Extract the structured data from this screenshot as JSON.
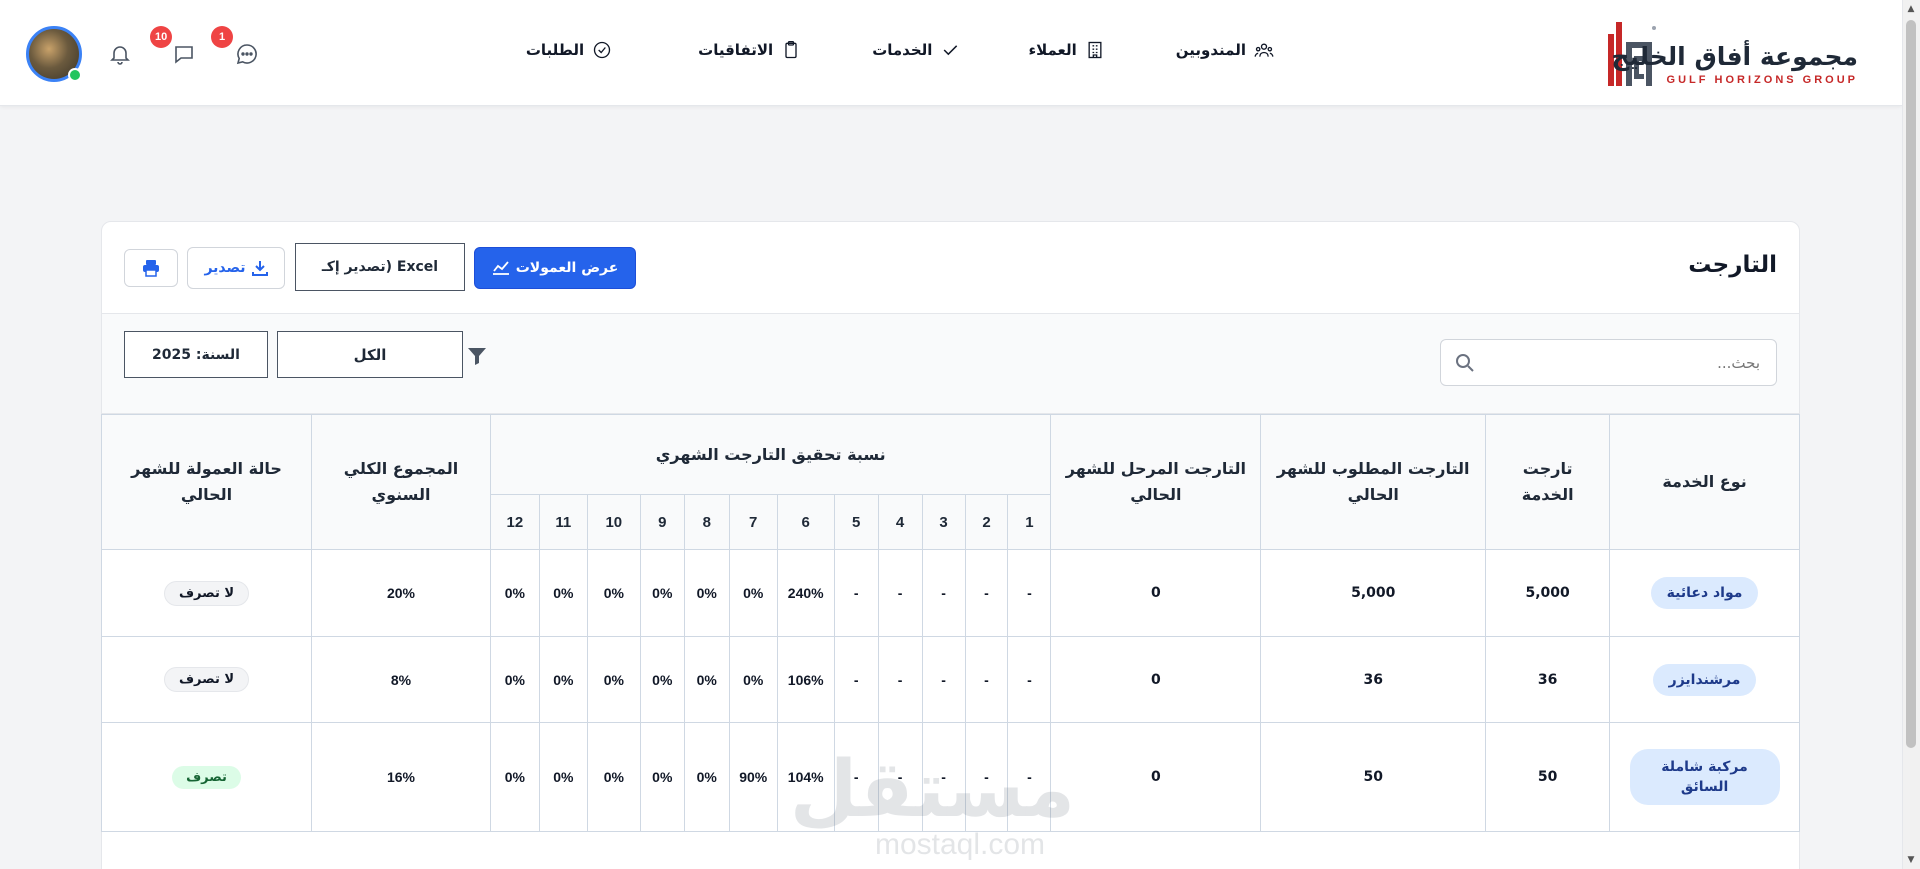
{
  "brand": {
    "name_ar": "مجموعة أفاق الخليج",
    "name_en": "GULF HORIZONS GROUP",
    "accent": "#c62828"
  },
  "nav": {
    "items": [
      {
        "label": "المندوبين",
        "icon": "users-icon"
      },
      {
        "label": "العملاء",
        "icon": "building-icon"
      },
      {
        "label": "الخدمات",
        "icon": "check-icon"
      },
      {
        "label": "الاتفاقيات",
        "icon": "clipboard-icon"
      },
      {
        "label": "الطلبات",
        "icon": "check-circle-icon"
      }
    ]
  },
  "header": {
    "messages_badge": "1",
    "notifications_badge": "10",
    "online_color": "#22c55e"
  },
  "page": {
    "title": "التارجت",
    "show_commissions_label": "عرض العمولات",
    "export_select_value": "Excel (تصدير إكـ",
    "export_label": "تصدير",
    "primary_color": "#2563eb"
  },
  "filters": {
    "search_placeholder": "بحث...",
    "type_value": "الكل",
    "year_value": "السنة: 2025"
  },
  "table": {
    "headers": {
      "service_type": "نوع الخدمة",
      "service_target": "تارجت الخدمة",
      "required_target": "التارجت المطلوب للشهر الحالي",
      "carried_target": "التارجت المرحل للشهر الحالي",
      "monthly_achievement": "نسبة تحقيق التارجت الشهري",
      "annual_total": "المجموع الكلي السنوي",
      "commission_status": "حالة العمولة للشهر الحالي"
    },
    "months": [
      "1",
      "2",
      "3",
      "4",
      "5",
      "6",
      "7",
      "8",
      "9",
      "10",
      "11",
      "12"
    ],
    "rows": [
      {
        "service": "مواد دعائية",
        "target": "5,000",
        "required": "5,000",
        "carried": "0",
        "monthly": [
          "-",
          "-",
          "-",
          "-",
          "-",
          "240%",
          "0%",
          "0%",
          "0%",
          "0%",
          "0%",
          "0%"
        ],
        "annual": "20%",
        "status": "لا تصرف"
      },
      {
        "service": "مرشندايزر",
        "target": "36",
        "required": "36",
        "carried": "0",
        "monthly": [
          "-",
          "-",
          "-",
          "-",
          "-",
          "106%",
          "0%",
          "0%",
          "0%",
          "0%",
          "0%",
          "0%"
        ],
        "annual": "8%",
        "status": "لا تصرف"
      },
      {
        "service": "مركبة شاملة السائق",
        "target": "50",
        "required": "50",
        "carried": "0",
        "monthly": [
          "-",
          "-",
          "-",
          "-",
          "-",
          "104%",
          "90%",
          "0%",
          "0%",
          "0%",
          "0%",
          "0%"
        ],
        "annual": "16%",
        "status": "تصرف"
      }
    ]
  },
  "watermark": {
    "ar": "مستقل",
    "en": "mostaql.com"
  }
}
